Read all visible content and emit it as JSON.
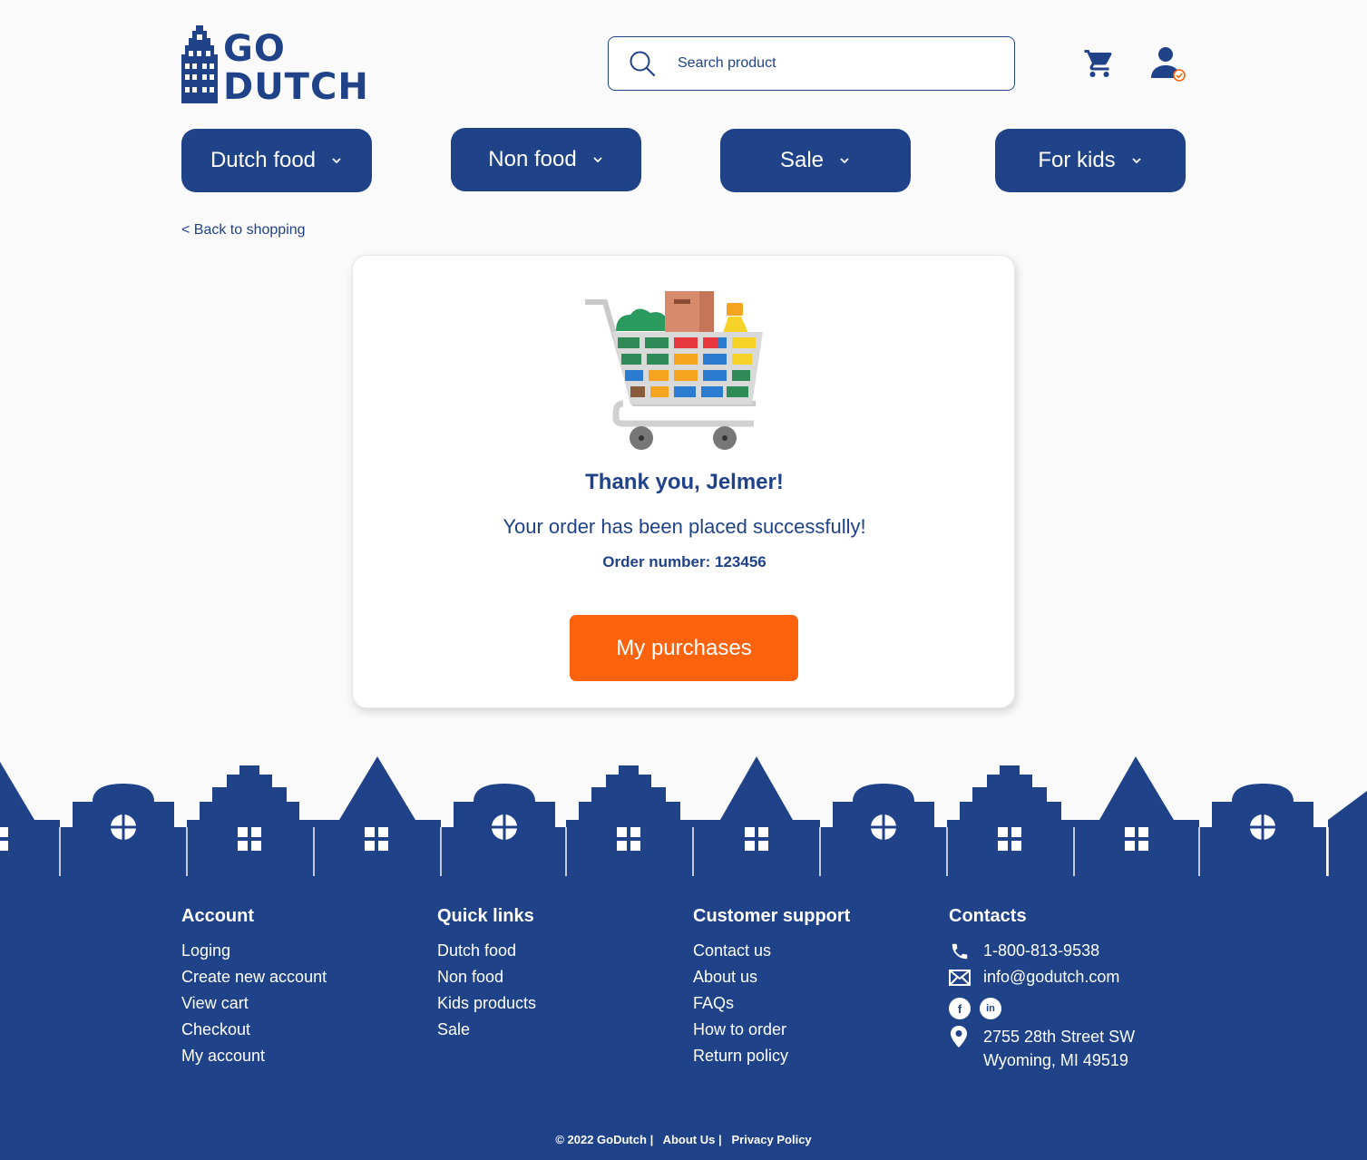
{
  "brand": {
    "logo_line1": "GO",
    "logo_line2": "DUTCH"
  },
  "search": {
    "placeholder": "Search product"
  },
  "nav": [
    {
      "label": "Dutch food"
    },
    {
      "label": "Non food"
    },
    {
      "label": "Sale"
    },
    {
      "label": "For kids"
    }
  ],
  "back_link": "< Back to shopping",
  "confirmation": {
    "title": "Thank you, Jelmer!",
    "message": "Your order has been placed successfully!",
    "order_number": "Order number: 123456",
    "button": "My purchases"
  },
  "footer": {
    "account": {
      "heading": "Account",
      "links": [
        "Loging",
        "Create new account",
        "View cart",
        "Checkout",
        "My account"
      ]
    },
    "quick_links": {
      "heading": "Quick links",
      "links": [
        "Dutch food",
        "Non food",
        "Kids products",
        "Sale"
      ]
    },
    "support": {
      "heading": "Customer support",
      "links": [
        "Contact us",
        "About us",
        "FAQs",
        "How to order",
        "Return policy"
      ]
    },
    "contacts": {
      "heading": "Contacts",
      "phone": "1-800-813-9538",
      "email": "info@godutch.com",
      "facebook": "f",
      "linkedin": "in",
      "address_line1": "2755 28th Street SW",
      "address_line2": "Wyoming, MI 49519"
    },
    "copyright": "© 2022 GoDutch",
    "about": "About Us",
    "privacy": "Privacy Policy"
  },
  "colors": {
    "primary": "#1f4288",
    "accent": "#fd620d"
  }
}
